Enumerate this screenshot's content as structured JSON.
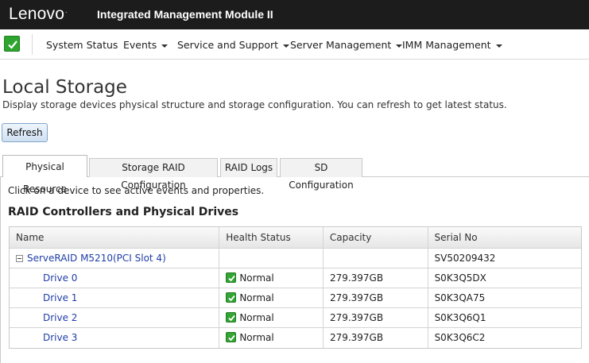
{
  "header": {
    "brand": "Lenovo",
    "brand_mark": ".",
    "product": "Integrated Management Module II"
  },
  "nav": {
    "status_icon": "check-icon",
    "items": [
      {
        "label": "System Status",
        "dropdown": false
      },
      {
        "label": "Events",
        "dropdown": true
      },
      {
        "label": "Service and Support",
        "dropdown": true
      },
      {
        "label": "Server Management",
        "dropdown": true
      },
      {
        "label": "IMM Management",
        "dropdown": true
      }
    ]
  },
  "page": {
    "title": "Local Storage",
    "description": "Display storage devices physical structure and storage configuration. You can refresh to get latest status.",
    "refresh_label": "Refresh"
  },
  "tabs": [
    {
      "label": "Physical Resource",
      "active": true
    },
    {
      "label": "Storage RAID Configuration",
      "active": false
    },
    {
      "label": "RAID Logs",
      "active": false
    },
    {
      "label": "SD Configuration",
      "active": false
    }
  ],
  "content": {
    "hint": "Click on a device to see active events and properties.",
    "section_title": "RAID Controllers and Physical Drives"
  },
  "table": {
    "columns": [
      "Name",
      "Health Status",
      "Capacity",
      "Serial No"
    ],
    "controller": {
      "name": "ServeRAID M5210(PCI Slot 4)",
      "health": "",
      "capacity": "",
      "serial": "SV50209432"
    },
    "drives": [
      {
        "name": "Drive 0",
        "health": "Normal",
        "capacity": "279.397GB",
        "serial": "S0K3Q5DX"
      },
      {
        "name": "Drive 1",
        "health": "Normal",
        "capacity": "279.397GB",
        "serial": "S0K3QA75"
      },
      {
        "name": "Drive 2",
        "health": "Normal",
        "capacity": "279.397GB",
        "serial": "S0K3Q6Q1"
      },
      {
        "name": "Drive 3",
        "health": "Normal",
        "capacity": "279.397GB",
        "serial": "S0K3Q6C2"
      }
    ]
  },
  "colors": {
    "header_bg": "#1c1c1c",
    "status_ok": "#2ea52e",
    "link": "#1f3ea8"
  }
}
